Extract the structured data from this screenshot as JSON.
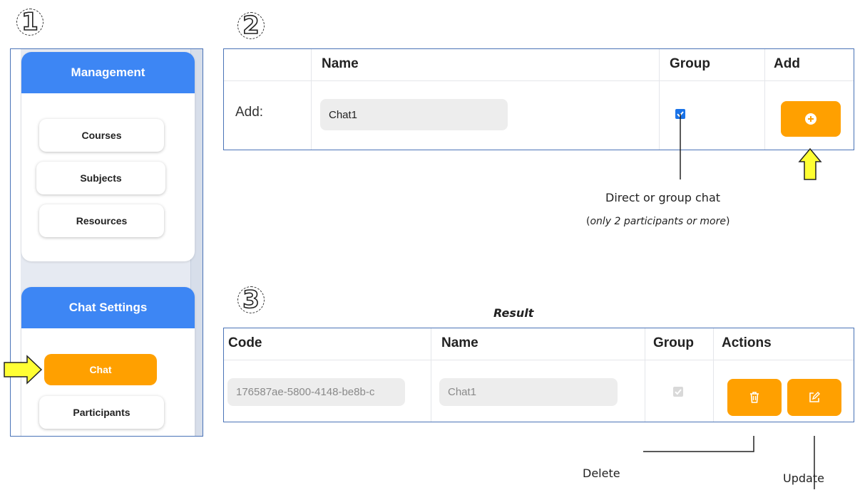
{
  "steps": [
    "1",
    "2",
    "3"
  ],
  "sidebar": {
    "management": {
      "title": "Management",
      "items": [
        "Courses",
        "Subjects",
        "Resources"
      ]
    },
    "chat_settings": {
      "title": "Chat Settings",
      "items": [
        "Chat",
        "Participants"
      ],
      "active": "Chat"
    }
  },
  "add_form": {
    "headers": {
      "name": "Name",
      "group": "Group",
      "add": "Add"
    },
    "row_label": "Add:",
    "name_value": "Chat1",
    "group_checked": true,
    "add_icon": "plus-circle-icon",
    "colors": {
      "accent": "#ffa000",
      "checkbox": "#1a73e8"
    }
  },
  "annotations": {
    "group_title": "Direct or group chat",
    "group_note_open": "(",
    "group_note": "only 2 participants or more",
    "group_note_close": ")",
    "result_title": "Result",
    "delete": "Delete",
    "update": "Update"
  },
  "result_table": {
    "headers": {
      "code": "Code",
      "name": "Name",
      "group": "Group",
      "actions": "Actions"
    },
    "row": {
      "code": "176587ae-5800-4148-be8b-c",
      "name": "Chat1",
      "group_checked": true
    },
    "delete_icon": "trash-icon",
    "update_icon": "edit-icon"
  }
}
